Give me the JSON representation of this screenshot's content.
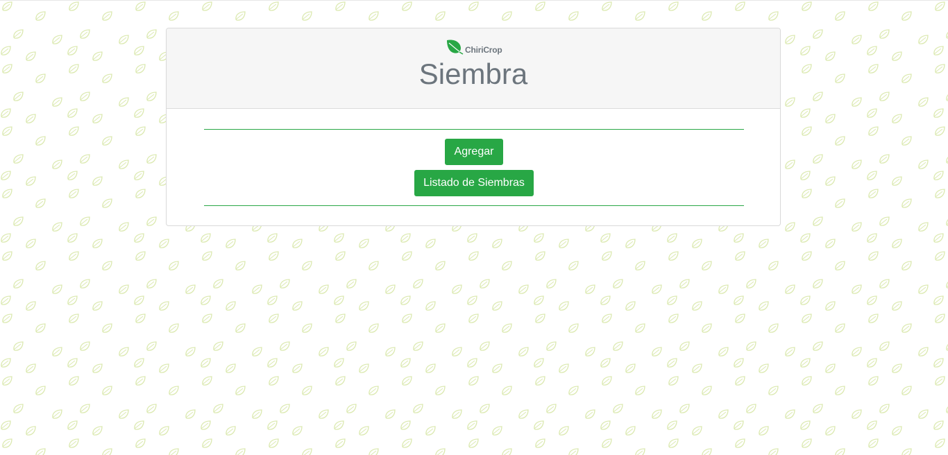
{
  "brand": {
    "name": "ChiriCrop",
    "icon": "leaf-icon",
    "color": "#28a745"
  },
  "header": {
    "title": "Siembra"
  },
  "actions": {
    "add_label": "Agregar",
    "list_label": "Listado de Siembras"
  },
  "theme": {
    "accent": "#28a745",
    "title_color": "#6c757d",
    "header_bg": "#f6f6f6",
    "pattern_color": "#dbe9b0"
  }
}
